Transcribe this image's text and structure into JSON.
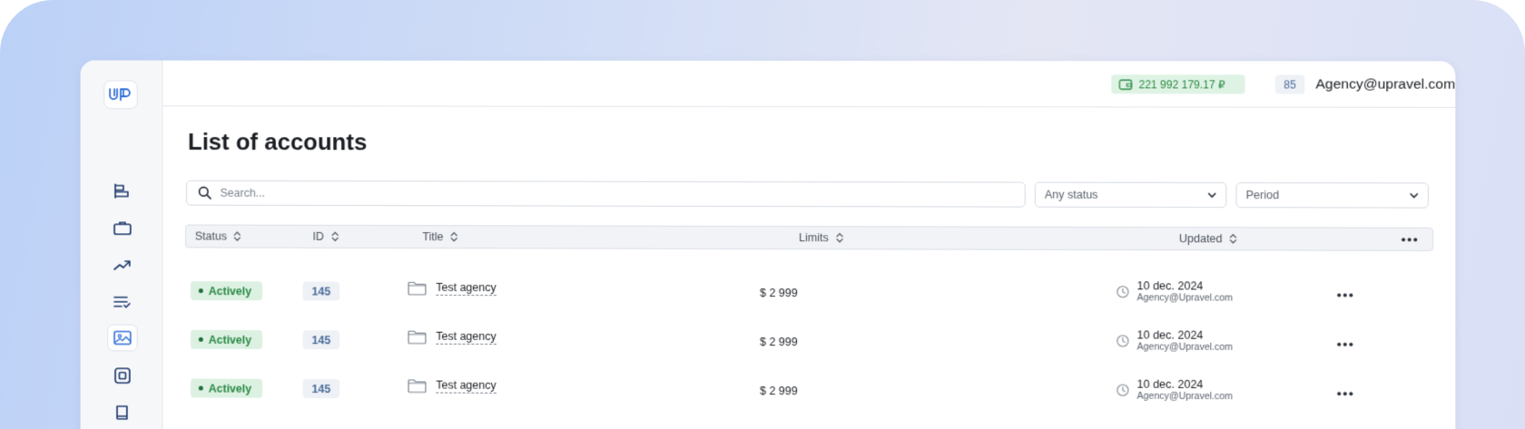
{
  "topbar": {
    "balance": "221 992 179.17 ₽",
    "notifications_count": "85",
    "user_email": "Agency@upravel.com"
  },
  "sidebar": {
    "logo_text": "UP",
    "items": [
      {
        "icon": "dashboard-icon",
        "active": false
      },
      {
        "icon": "briefcase-icon",
        "active": false
      },
      {
        "icon": "trending-up-icon",
        "active": false
      },
      {
        "icon": "list-check-icon",
        "active": false
      },
      {
        "icon": "image-icon",
        "active": true
      },
      {
        "icon": "square-icon",
        "active": false
      },
      {
        "icon": "book-icon",
        "active": false
      }
    ]
  },
  "page": {
    "title": "List of accounts"
  },
  "filters": {
    "search_placeholder": "Search...",
    "status_select": "Any status",
    "period_select": "Period"
  },
  "table": {
    "columns": [
      "Status",
      "ID",
      "Title",
      "Limits",
      "Updated"
    ],
    "rows": [
      {
        "status": "Actively",
        "id": "145",
        "title": "Test agency",
        "limit": "$ 2 999",
        "updated_date": "10 dec. 2024",
        "updated_by": "Agency@Upravel.com"
      },
      {
        "status": "Actively",
        "id": "145",
        "title": "Test agency",
        "limit": "$ 2 999",
        "updated_date": "10 dec. 2024",
        "updated_by": "Agency@Upravel.com"
      },
      {
        "status": "Actively",
        "id": "145",
        "title": "Test agency",
        "limit": "$ 2 999",
        "updated_date": "10 dec. 2024",
        "updated_by": "Agency@Upravel.com"
      }
    ]
  },
  "colors": {
    "accent_blue": "#2f6fd6",
    "status_green_bg": "#dcf1e2",
    "status_green_text": "#2b8a45"
  }
}
